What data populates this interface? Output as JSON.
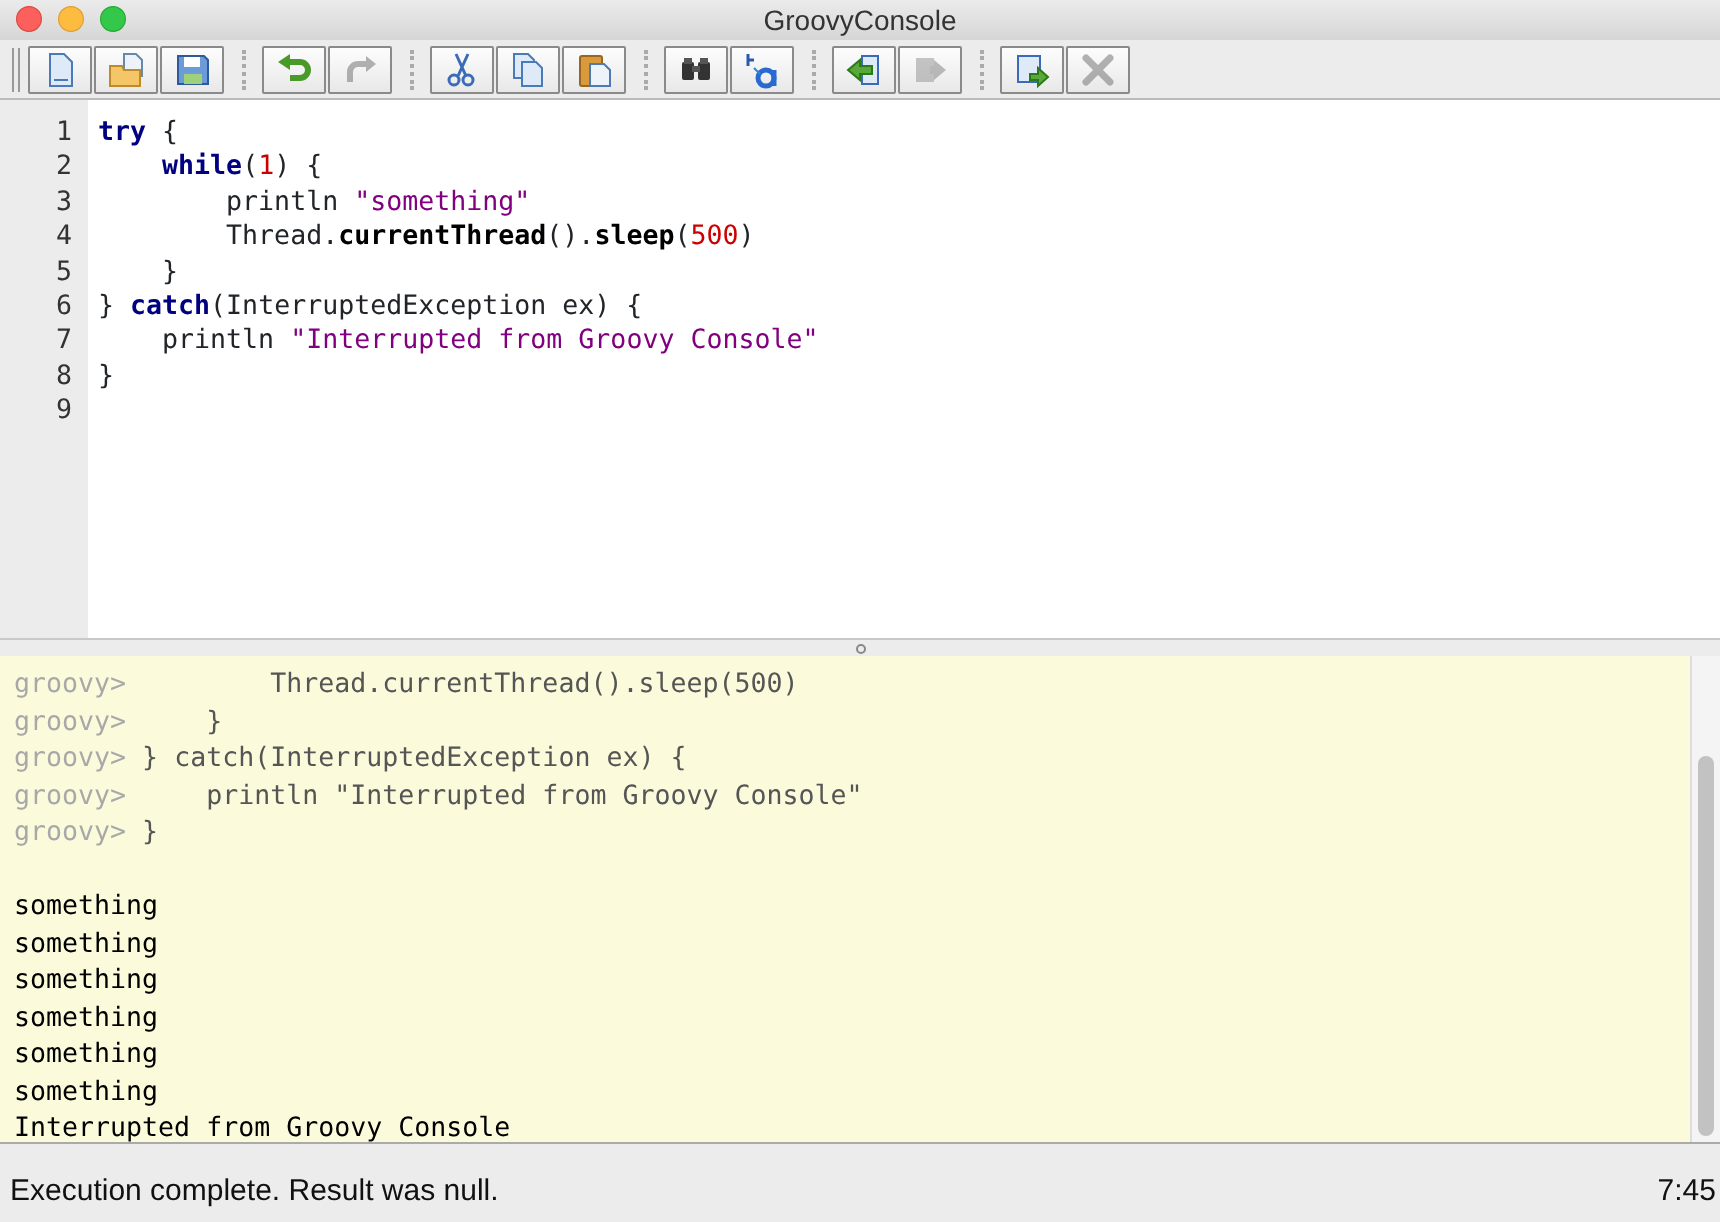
{
  "window": {
    "title": "GroovyConsole"
  },
  "toolbar": [
    [
      {
        "kind": "new",
        "disabled": false
      },
      {
        "kind": "open",
        "disabled": false
      },
      {
        "kind": "save",
        "disabled": false
      }
    ],
    [
      {
        "kind": "undo",
        "disabled": false
      },
      {
        "kind": "redo",
        "disabled": true
      }
    ],
    [
      {
        "kind": "cut",
        "disabled": false
      },
      {
        "kind": "copy",
        "disabled": false
      },
      {
        "kind": "paste",
        "disabled": false
      }
    ],
    [
      {
        "kind": "find",
        "disabled": false
      },
      {
        "kind": "replace",
        "disabled": false
      }
    ],
    [
      {
        "kind": "back",
        "disabled": false
      },
      {
        "kind": "forward",
        "disabled": true
      }
    ],
    [
      {
        "kind": "run",
        "disabled": false
      },
      {
        "kind": "interrupt",
        "disabled": true
      }
    ]
  ],
  "editor": {
    "lines": [
      {
        "number": "1",
        "tokens": [
          {
            "kind": "keyword",
            "text": "try"
          },
          {
            "kind": "plain",
            "text": " {"
          }
        ]
      },
      {
        "number": "2",
        "tokens": [
          {
            "kind": "keyword",
            "text": "    while"
          },
          {
            "kind": "plain",
            "text": "("
          },
          {
            "kind": "number",
            "text": "1"
          },
          {
            "kind": "plain",
            "text": ") {"
          }
        ]
      },
      {
        "number": "3",
        "tokens": [
          {
            "kind": "plain",
            "text": "        println "
          },
          {
            "kind": "string",
            "text": "\"something\""
          }
        ]
      },
      {
        "number": "4",
        "tokens": [
          {
            "kind": "plain",
            "text": "        Thread."
          },
          {
            "kind": "method",
            "text": "currentThread"
          },
          {
            "kind": "plain",
            "text": "()."
          },
          {
            "kind": "method",
            "text": "sleep"
          },
          {
            "kind": "plain",
            "text": "("
          },
          {
            "kind": "number",
            "text": "500"
          },
          {
            "kind": "plain",
            "text": ")"
          }
        ]
      },
      {
        "number": "5",
        "tokens": [
          {
            "kind": "plain",
            "text": "    }"
          }
        ]
      },
      {
        "number": "6",
        "tokens": [
          {
            "kind": "plain",
            "text": "} "
          },
          {
            "kind": "keyword",
            "text": "catch"
          },
          {
            "kind": "plain",
            "text": "(InterruptedException ex) {"
          }
        ]
      },
      {
        "number": "7",
        "tokens": [
          {
            "kind": "plain",
            "text": "    println "
          },
          {
            "kind": "string",
            "text": "\"Interrupted from Groovy Console\""
          }
        ]
      },
      {
        "number": "8",
        "tokens": [
          {
            "kind": "plain",
            "text": "}"
          }
        ]
      },
      {
        "number": "9"
      }
    ]
  },
  "output": {
    "lines": [
      {
        "kind": "echo",
        "prompt": "groovy>",
        "text": "         Thread.currentThread().sleep(500)"
      },
      {
        "kind": "echo",
        "prompt": "groovy>",
        "text": "     }"
      },
      {
        "kind": "echo",
        "prompt": "groovy>",
        "text": " } catch(InterruptedException ex) {"
      },
      {
        "kind": "echo",
        "prompt": "groovy>",
        "text": "     println \"Interrupted from Groovy Console\""
      },
      {
        "kind": "echo",
        "prompt": "groovy>",
        "text": " }"
      },
      {
        "kind": "blank"
      },
      {
        "kind": "result",
        "text": "something"
      },
      {
        "kind": "result",
        "text": "something"
      },
      {
        "kind": "result",
        "text": "something"
      },
      {
        "kind": "result",
        "text": "something"
      },
      {
        "kind": "result",
        "text": "something"
      },
      {
        "kind": "result",
        "text": "something"
      },
      {
        "kind": "result",
        "text": "Interrupted from Groovy Console"
      }
    ]
  },
  "status_bar": {
    "message": "Execution complete. Result was null.",
    "position": "7:45"
  }
}
